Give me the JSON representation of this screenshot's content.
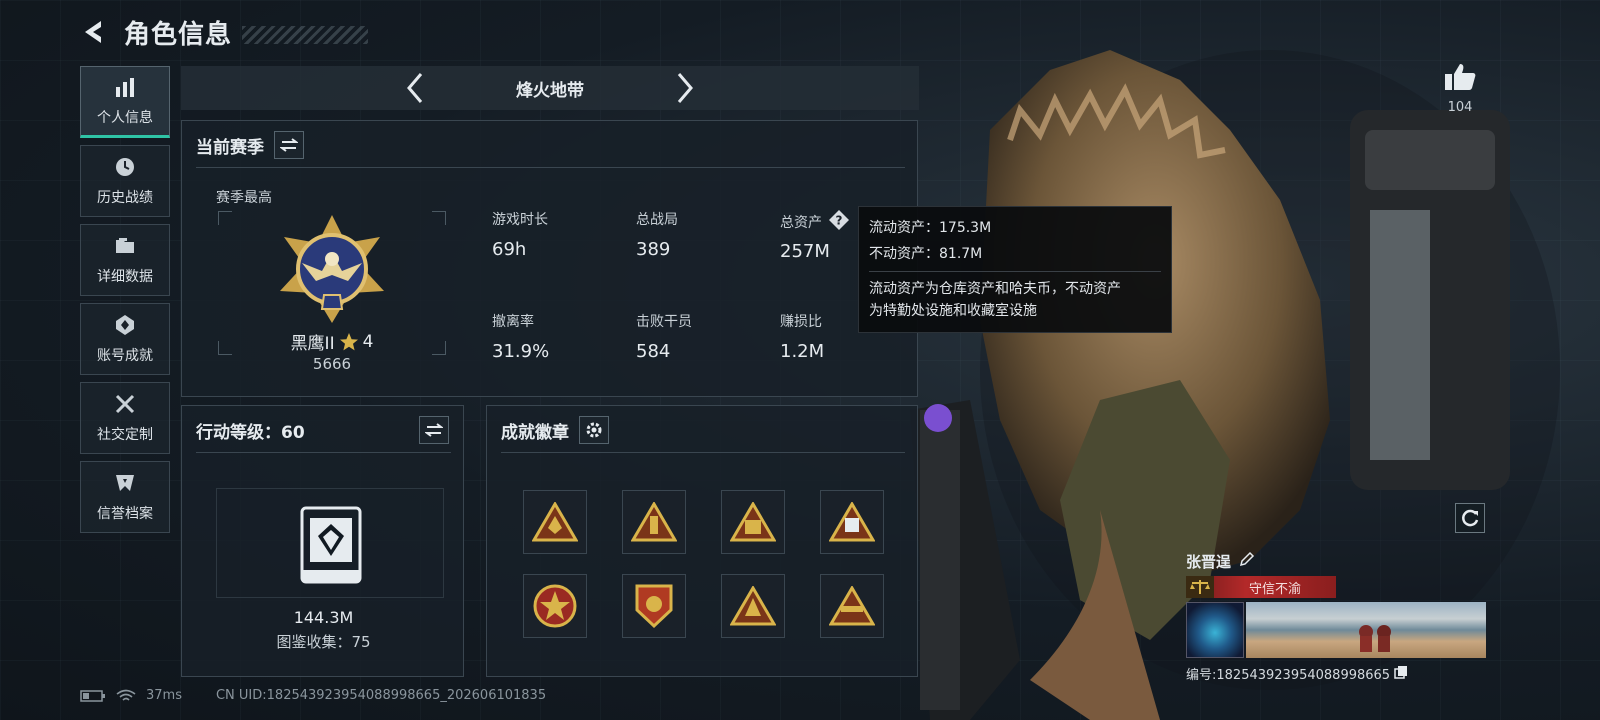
{
  "header": {
    "title": "角色信息"
  },
  "sidebar": {
    "items": [
      {
        "label": "个人信息",
        "icon": "bar-chart-icon",
        "active": true
      },
      {
        "label": "历史战绩",
        "icon": "history-icon",
        "active": false
      },
      {
        "label": "详细数据",
        "icon": "folder-icon",
        "active": false
      },
      {
        "label": "账号成就",
        "icon": "achievement-icon",
        "active": false
      },
      {
        "label": "社交定制",
        "icon": "tools-icon",
        "active": false
      },
      {
        "label": "信誉档案",
        "icon": "credit-shield-icon",
        "active": false
      }
    ]
  },
  "mode": {
    "title": "烽火地带"
  },
  "season": {
    "title": "当前赛季",
    "season_high": "赛季最高",
    "rank_name": "黑鹰II",
    "rank_stars": "4",
    "rank_score": "5666",
    "stats": [
      {
        "label": "游戏时长",
        "value": "69h"
      },
      {
        "label": "总战局",
        "value": "389"
      },
      {
        "label": "总资产",
        "value": "257M"
      },
      {
        "label": "撤离率",
        "value": "31.9%"
      },
      {
        "label": "击败干员",
        "value": "584"
      },
      {
        "label": "赚损比",
        "value": "1.2M"
      }
    ]
  },
  "tooltip": {
    "liquid": "流动资产：175.3M",
    "fixed": "不动资产：81.7M",
    "desc_line1": "流动资产为仓库资产和哈夫币，不动资产",
    "desc_line2": "为特勤处设施和收藏室设施"
  },
  "level": {
    "title": "行动等级：60",
    "value": "144.3M",
    "sub": "图鉴收集：75"
  },
  "badges": {
    "title": "成就徽章",
    "items": [
      "badge-1",
      "badge-2",
      "badge-3",
      "badge-4",
      "badge-5",
      "badge-6",
      "badge-7",
      "badge-8"
    ]
  },
  "player": {
    "likes": "104",
    "name": "张晋逞",
    "credit": "守信不渝",
    "id": "编号:1825439239540889986​65"
  },
  "status": {
    "ping": "37ms",
    "uid": "CN UID:18254392395408899866​5_202606101835"
  },
  "colors": {
    "accent": "#2fc4a6",
    "credit_red": "#b32929",
    "gold": "#c9a24a"
  }
}
